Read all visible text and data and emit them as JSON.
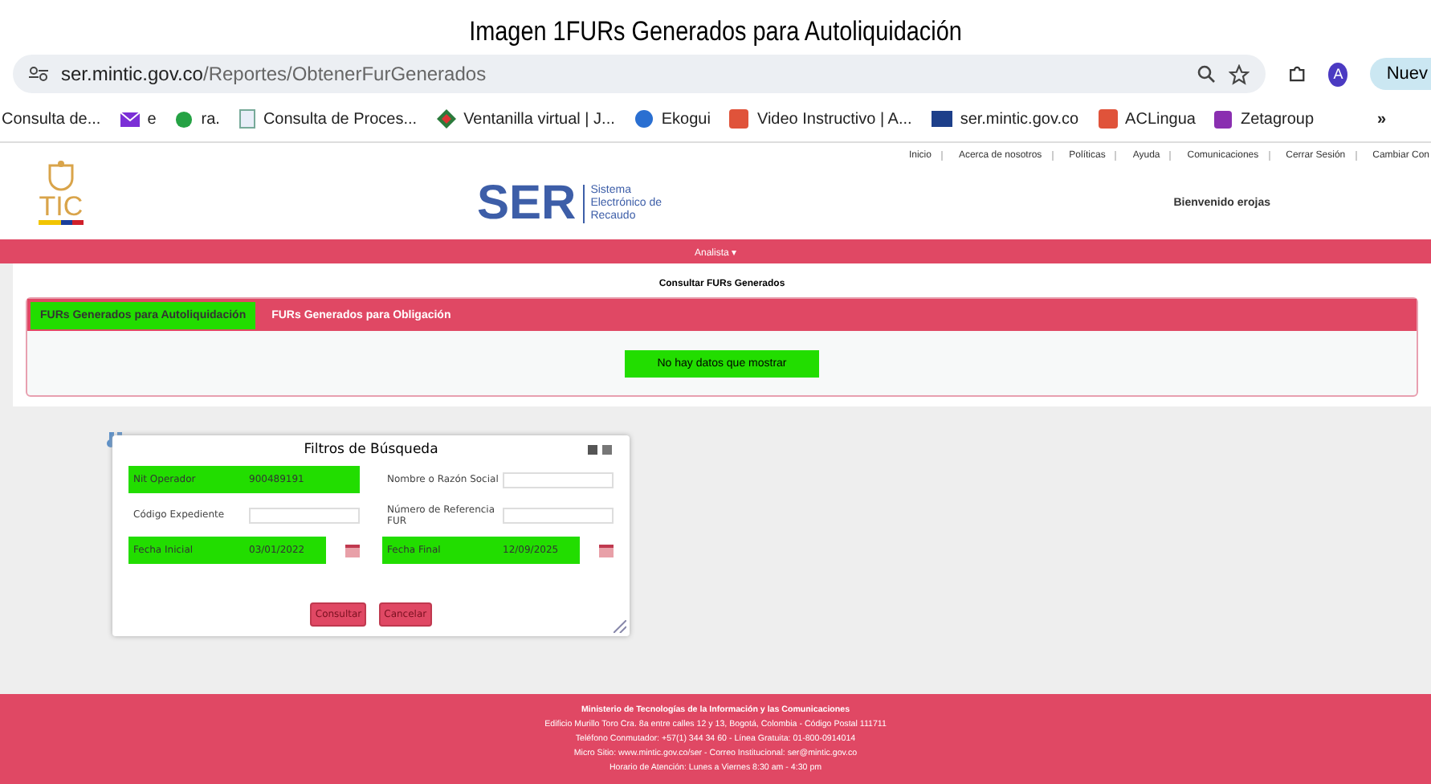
{
  "caption": "Imagen 1FURs Generados para Autoliquidación",
  "browser": {
    "url_host": "ser.mintic.gov.co",
    "url_path": "/Reportes/ObtenerFurGenerados",
    "avatar": "A",
    "new_button": "Nuev",
    "overflow": "»"
  },
  "bookmarks": [
    {
      "label": "Consulta de...",
      "kind": "none"
    },
    {
      "label": "e",
      "kind": "mail"
    },
    {
      "label": "ra.",
      "kind": "chat"
    },
    {
      "label": "Consulta de Proces...",
      "kind": "doc"
    },
    {
      "label": "Ventanilla virtual | J...",
      "kind": "diamond"
    },
    {
      "label": "Ekogui",
      "kind": "globe"
    },
    {
      "label": "Video Instructivo | A...",
      "kind": "ac"
    },
    {
      "label": "ser.mintic.gov.co",
      "kind": "ser"
    },
    {
      "label": "ACLingua",
      "kind": "ac"
    },
    {
      "label": "Zetagroup",
      "kind": "square"
    }
  ],
  "top_links": [
    "Inicio",
    "Acerca de nosotros",
    "Políticas",
    "Ayuda",
    "Comunicaciones",
    "Cerrar Sesión",
    "Cambiar Con"
  ],
  "logo": {
    "tic": "TIC",
    "ser": "SER",
    "ser_sub": [
      "Sistema",
      "Electrónico de",
      "Recaudo"
    ]
  },
  "welcome": "Bienvenido erojas",
  "nav": {
    "menu": "Analista",
    "caret": "▾"
  },
  "results": {
    "title": "Consultar FURs Generados",
    "tabs": [
      {
        "label": "FURs Generados para Autoliquidación",
        "selected": true
      },
      {
        "label": "FURs Generados para Obligación",
        "selected": false
      }
    ],
    "empty_message": "No hay datos que mostrar"
  },
  "filters": {
    "title": "Filtros de Búsqueda",
    "fields": [
      {
        "label": "Nit Operador",
        "value": "900489191",
        "kind": "text",
        "highlighted": true
      },
      {
        "label": "Nombre o Razón Social",
        "kind": "text",
        "highlighted": false
      },
      {
        "label": "Código Expediente",
        "kind": "text",
        "highlighted": false
      },
      {
        "label": "Número de Referencia FUR",
        "kind": "text",
        "highlighted": false
      },
      {
        "label": "Fecha Inicial",
        "value": "03/01/2022",
        "kind": "date",
        "highlighted": true
      },
      {
        "label": "Fecha Final",
        "value": "12/09/2025",
        "kind": "date",
        "highlighted": true
      }
    ],
    "buttons": [
      "Consultar",
      "Cancelar"
    ]
  },
  "footer": [
    "Ministerio de Tecnologías de la Información y las Comunicaciones",
    "Edificio Murillo Toro Cra. 8a entre calles 12 y 13, Bogotá, Colombia - Código Postal 111711",
    "Teléfono Conmutador: +57(1) 344 34 60 - Línea Gratuita: 01-800-0914014",
    "Micro Sitio: www.mintic.gov.co/ser - Correo Institucional: ser@mintic.gov.co",
    "Horario de Atención: Lunes a Viernes 8:30 am - 4:30 pm"
  ]
}
